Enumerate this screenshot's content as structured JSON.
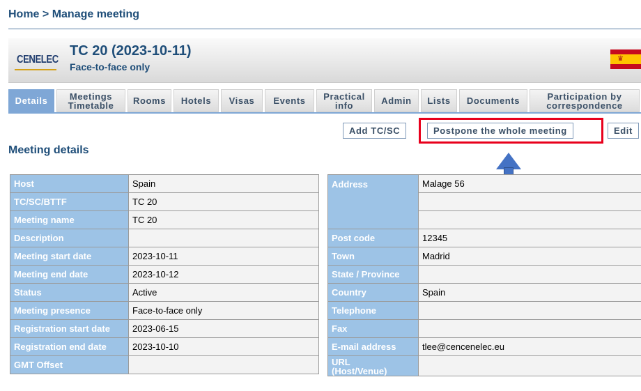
{
  "breadcrumb": "Home > Manage meeting",
  "header": {
    "logo": "CENELEC",
    "title": "TC 20 (2023-10-11)",
    "subtitle": "Face-to-face only",
    "flag": "spain-flag-icon"
  },
  "tabs": [
    {
      "label": "Details",
      "active": true
    },
    {
      "label": "Meetings Timetable"
    },
    {
      "label": "Rooms"
    },
    {
      "label": "Hotels"
    },
    {
      "label": "Visas"
    },
    {
      "label": "Events"
    },
    {
      "label": "Practical info"
    },
    {
      "label": "Admin"
    },
    {
      "label": "Lists"
    },
    {
      "label": "Documents"
    },
    {
      "label": "Participation by correspondence"
    }
  ],
  "actions": {
    "add": "Add TC/SC",
    "postpone": "Postpone the whole meeting",
    "edit": "Edit"
  },
  "section_title": "Meeting details",
  "left_rows": [
    {
      "label": "Host",
      "value": "Spain"
    },
    {
      "label": "TC/SC/BTTF",
      "value": "TC 20"
    },
    {
      "label": "Meeting name",
      "value": "TC 20"
    },
    {
      "label": "Description",
      "value": ""
    },
    {
      "label": "Meeting start date",
      "value": "2023-10-11"
    },
    {
      "label": "Meeting end date",
      "value": "2023-10-12"
    },
    {
      "label": "Status",
      "value": "Active"
    },
    {
      "label": "Meeting presence",
      "value": "Face-to-face only"
    },
    {
      "label": "Registration start date",
      "value": "2023-06-15"
    },
    {
      "label": "Registration end date",
      "value": "2023-10-10"
    },
    {
      "label": "GMT Offset",
      "value": ""
    }
  ],
  "right": {
    "address_label": "Address",
    "address_lines": [
      "Malage 56",
      "",
      ""
    ],
    "rows": [
      {
        "label": "Post code",
        "value": "12345"
      },
      {
        "label": "Town",
        "value": "Madrid"
      },
      {
        "label": "State / Province",
        "value": ""
      },
      {
        "label": "Country",
        "value": "Spain"
      },
      {
        "label": "Telephone",
        "value": ""
      },
      {
        "label": "Fax",
        "value": ""
      },
      {
        "label": "E-mail address",
        "value": "tlee@cencenelec.eu"
      }
    ],
    "url_label": "URL\n(Host/Venue)",
    "url_value": ""
  },
  "colors": {
    "accent_blue": "#1f4e79",
    "tab_active": "#7fa7d6",
    "label_cell": "#9dc3e6",
    "highlight": "#e8001c",
    "arrow": "#4472c4"
  }
}
